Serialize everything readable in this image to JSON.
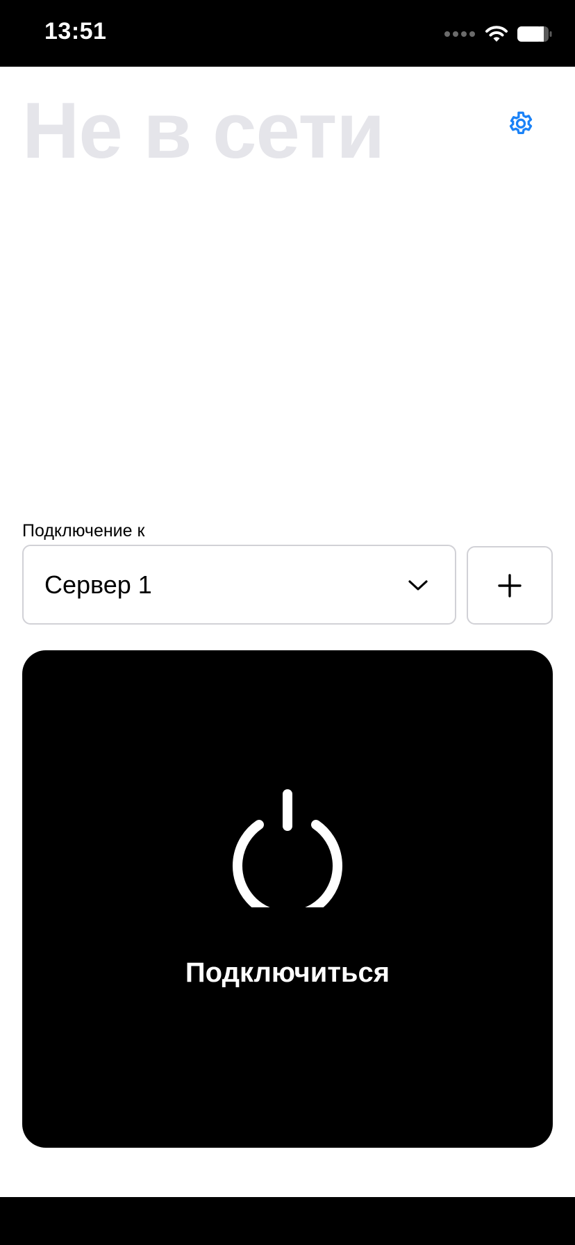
{
  "status_bar": {
    "time": "13:51",
    "icons": [
      "signal-dots-icon",
      "wifi-icon",
      "battery-icon"
    ]
  },
  "header": {
    "title": "Не в сети",
    "settings_icon": "gear-icon"
  },
  "connection": {
    "label": "Подключение к",
    "selected_server": "Сервер 1",
    "dropdown_icon": "chevron-down-icon",
    "add_icon": "plus-icon"
  },
  "connect_panel": {
    "label": "Подключиться",
    "icon": "power-icon"
  },
  "colors": {
    "accent": "#1a82f7",
    "title_inactive": "#e5e5ea",
    "panel_background": "#000000",
    "border": "#d1d1d6"
  }
}
